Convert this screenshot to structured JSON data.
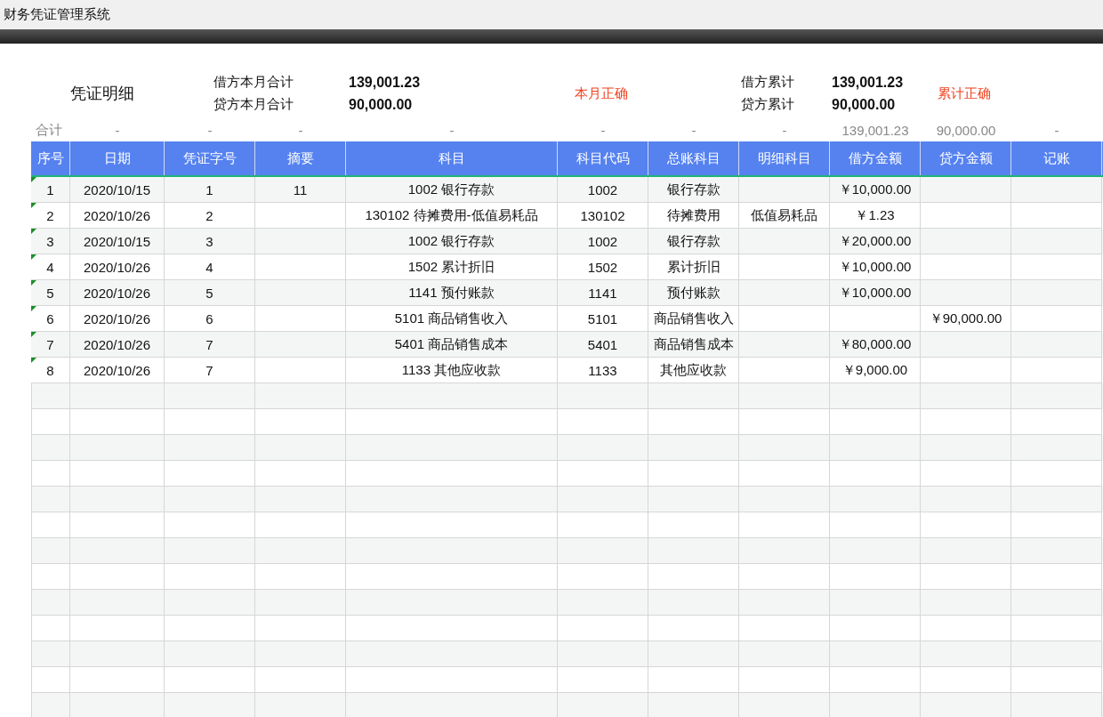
{
  "window": {
    "title": "财务凭证管理系统"
  },
  "summary": {
    "title": "凭证明细",
    "month": [
      {
        "label": "借方本月合计",
        "value": "139,001.23"
      },
      {
        "label": "贷方本月合计",
        "value": "90,000.00"
      }
    ],
    "month_status": "本月正确",
    "cumulative": [
      {
        "label": "借方累计",
        "value": "139,001.23"
      },
      {
        "label": "贷方累计",
        "value": "90,000.00"
      }
    ],
    "cumulative_status": "累计正确"
  },
  "totals": {
    "label": "合计",
    "values": [
      "-",
      "-",
      "-",
      "-",
      "-",
      "-",
      "-",
      "139,001.23",
      "90,000.00",
      "-"
    ]
  },
  "table": {
    "columns": [
      "序号",
      "日期",
      "凭证字号",
      "摘要",
      "科目",
      "科目代码",
      "总账科目",
      "明细科目",
      "借方金额",
      "贷方金额",
      "记账"
    ],
    "rows": [
      {
        "cells": [
          "1",
          "2020/10/15",
          "1",
          "11",
          "1002 银行存款",
          "1002",
          "银行存款",
          null,
          "￥10,000.00",
          null,
          null
        ]
      },
      {
        "cells": [
          "2",
          "2020/10/26",
          "2",
          null,
          "130102 待摊费用-低值易耗品",
          "130102",
          "待摊费用",
          "低值易耗品",
          "￥1.23",
          null,
          null
        ]
      },
      {
        "cells": [
          "3",
          "2020/10/15",
          "3",
          null,
          "1002 银行存款",
          "1002",
          "银行存款",
          null,
          "￥20,000.00",
          null,
          null
        ]
      },
      {
        "cells": [
          "4",
          "2020/10/26",
          "4",
          null,
          "1502 累计折旧",
          "1502",
          "累计折旧",
          null,
          "￥10,000.00",
          null,
          null
        ]
      },
      {
        "cells": [
          "5",
          "2020/10/26",
          "5",
          null,
          "1141 预付账款",
          "1141",
          "预付账款",
          null,
          "￥10,000.00",
          null,
          null
        ]
      },
      {
        "cells": [
          "6",
          "2020/10/26",
          "6",
          null,
          "5101 商品销售收入",
          "5101",
          "商品销售收入",
          null,
          null,
          "￥90,000.00",
          null
        ]
      },
      {
        "cells": [
          "7",
          "2020/10/26",
          "7",
          null,
          "5401 商品销售成本",
          "5401",
          "商品销售成本",
          null,
          "￥80,000.00",
          null,
          null
        ]
      },
      {
        "cells": [
          "8",
          "2020/10/26",
          "7",
          null,
          "1133 其他应收款",
          "1133",
          "其他应收款",
          null,
          "￥9,000.00",
          null,
          null
        ]
      }
    ]
  }
}
